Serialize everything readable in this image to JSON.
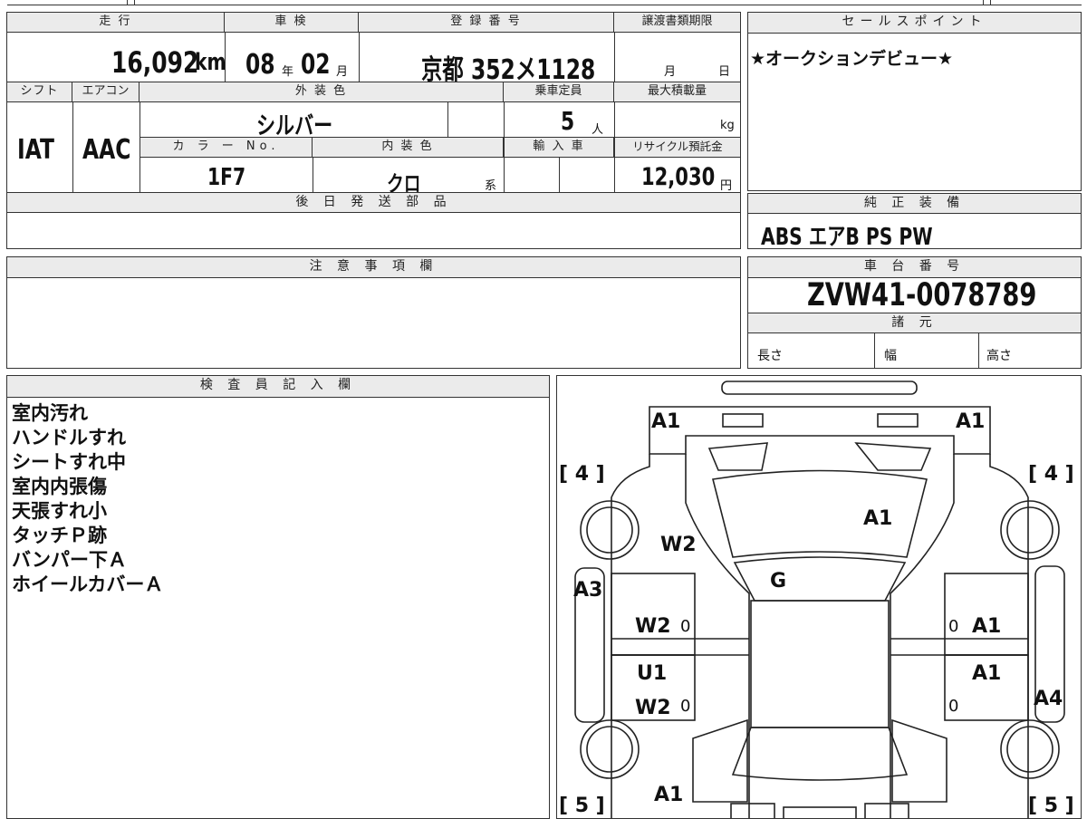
{
  "top": {
    "mileage_label": "走 行",
    "mileage_value": "16,092",
    "mileage_unit": "km",
    "inspection_label": "車 検",
    "inspection_year": "08",
    "inspection_year_unit": "年",
    "inspection_month": "02",
    "inspection_month_unit": "月",
    "registration_label": "登 録 番 号",
    "registration_value": "京都 352メ1128",
    "transfer_label": "譲渡書類期限",
    "transfer_month_unit": "月",
    "transfer_day_unit": "日"
  },
  "specs": {
    "shift_label": "シフト",
    "shift_value": "IAT",
    "aircon_label": "エアコン",
    "aircon_value": "AAC",
    "exterior_label": "外 装 色",
    "exterior_value": "シルバー",
    "capacity_label": "乗車定員",
    "capacity_value": "5",
    "capacity_unit": "人",
    "max_load_label": "最大積載量",
    "max_load_unit": "kg",
    "color_no_label": "カ ラ ー No.",
    "color_no_value": "1F7",
    "interior_label": "内 装 色",
    "interior_value": "クロ",
    "interior_suffix": "系",
    "import_label": "輸 入 車",
    "recycle_label": "リサイクル預託金",
    "recycle_value": "12,030",
    "recycle_unit": "円"
  },
  "later_parts": {
    "label": "後 日 発 送 部 品"
  },
  "sales_point": {
    "label": "セールスポイント",
    "text": "★オークションデビュー★"
  },
  "genuine_equipment": {
    "label": "純 正 装 備",
    "text": "ABS エアB PS PW"
  },
  "notes": {
    "label": "注 意 事 項 欄"
  },
  "chassis": {
    "label": "車 台 番 号",
    "value": "ZVW41-0078789"
  },
  "specifications": {
    "label": "諸 元",
    "length": "長さ",
    "width": "幅",
    "height": "高さ"
  },
  "inspector": {
    "label": "検 査 員 記 入 欄",
    "lines": [
      "室内汚れ",
      "ハンドルすれ",
      "シートすれ中",
      "室内内張傷",
      "天張すれ小",
      "タッチＰ跡",
      "バンパー下Ａ",
      "ホイールカバーＡ"
    ]
  },
  "diagram": {
    "marks": [
      "A1",
      "A1",
      "A1",
      "W2",
      "G",
      "A3",
      "W2",
      "A1",
      "U1",
      "A1",
      "W2",
      "A4",
      "A1"
    ],
    "small_marks": [
      "0",
      "0",
      "0",
      "0"
    ],
    "tires": [
      "[ 4 ]",
      "[ 4 ]",
      "[ 5 ]",
      "[ 5 ]"
    ]
  }
}
